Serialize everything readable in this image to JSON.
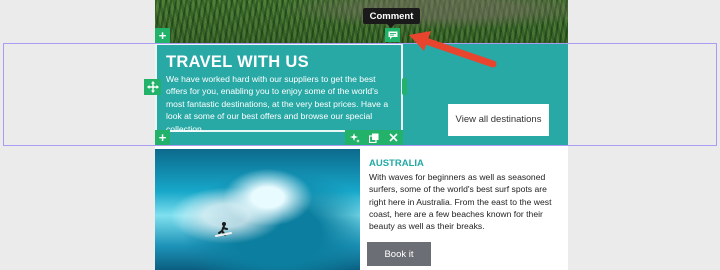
{
  "tooltip": {
    "comment": "Comment"
  },
  "banner": {
    "heading": "TRAVEL WITH US",
    "body": "We have worked hard with our suppliers to get the best offers for you, enabling you to enjoy some of the world's most fantastic destinations, at the very best prices. Have a look at some of our best offers and browse our special collection.",
    "cta_label": "View all destinations",
    "background_color": "#28a9a6"
  },
  "destination": {
    "title": "AUSTRALIA",
    "body": " With waves for beginners as well as seasoned surfers, some of the world's best surf spots are right here in Australia. From the east to the west coast, here are a few beaches known for their beauty as well as their breaks.",
    "button_label": "Book it"
  },
  "editor": {
    "add_symbol": "+",
    "accent_color": "#22b26a",
    "selection_color": "#a99cf2",
    "arrow_color": "#e8442e",
    "icons": [
      "plus-icon",
      "move-icon",
      "comment-icon",
      "ai-sparkle-icon",
      "duplicate-icon",
      "close-icon"
    ]
  }
}
